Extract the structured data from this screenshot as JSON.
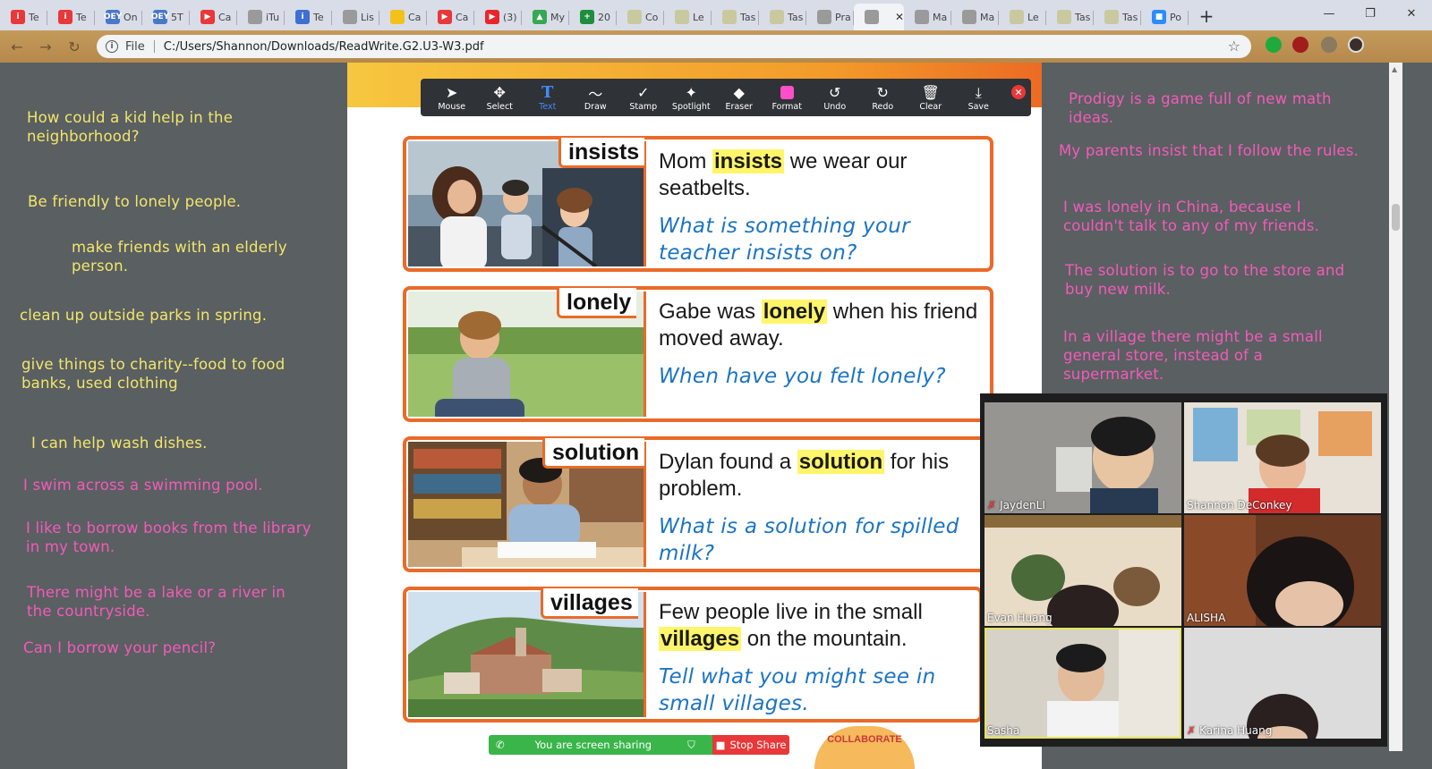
{
  "browser": {
    "tabs": [
      {
        "label": "Te",
        "color": "#e8383a",
        "glyph": "i"
      },
      {
        "label": "Te",
        "color": "#e8383a",
        "glyph": "i"
      },
      {
        "label": "On",
        "color": "#4a78c8",
        "glyph": "OEY"
      },
      {
        "label": "5T",
        "color": "#4a78c8",
        "glyph": "OEY"
      },
      {
        "label": "Ca",
        "color": "#e8383a",
        "glyph": "▶"
      },
      {
        "label": "iTu",
        "color": "#9a9a9a",
        "glyph": ""
      },
      {
        "label": "Te",
        "color": "#3f6fd0",
        "glyph": "i"
      },
      {
        "label": "Lis",
        "color": "#9a9a9a",
        "glyph": ""
      },
      {
        "label": "Ca",
        "color": "#f3c21a",
        "glyph": ""
      },
      {
        "label": "Ca",
        "color": "#e8383a",
        "glyph": "▶"
      },
      {
        "label": "(3)",
        "color": "#e8262a",
        "glyph": "▶"
      },
      {
        "label": "My",
        "color": "#34a853",
        "glyph": "▲"
      },
      {
        "label": "20",
        "color": "#1e8e3e",
        "glyph": "+"
      },
      {
        "label": "Co",
        "color": "#c9c9a0",
        "glyph": ""
      },
      {
        "label": "Le",
        "color": "#c9c9a0",
        "glyph": ""
      },
      {
        "label": "Tas",
        "color": "#c9c9a0",
        "glyph": ""
      },
      {
        "label": "Tas",
        "color": "#c9c9a0",
        "glyph": ""
      },
      {
        "label": "Pra",
        "color": "#9a9a9a",
        "glyph": ""
      },
      {
        "label": "",
        "color": "#9a9a9a",
        "glyph": "",
        "active": true
      },
      {
        "label": "Ma",
        "color": "#9a9a9a",
        "glyph": ""
      },
      {
        "label": "Ma",
        "color": "#9a9a9a",
        "glyph": ""
      },
      {
        "label": "Le",
        "color": "#c9c9a0",
        "glyph": ""
      },
      {
        "label": "Tas",
        "color": "#c9c9a0",
        "glyph": ""
      },
      {
        "label": "Tas",
        "color": "#c9c9a0",
        "glyph": ""
      },
      {
        "label": "Po",
        "color": "#2d8cff",
        "glyph": "■"
      }
    ],
    "new_tab": "+",
    "close_tab": "✕",
    "window": {
      "minimize": "—",
      "restore": "❐",
      "close": "✕"
    },
    "nav": {
      "back": "←",
      "forward": "→",
      "reload": "↻"
    },
    "address": {
      "scheme_label": "File",
      "url": "C:/Users/Shannon/Downloads/ReadWrite.G2.U3-W3.pdf"
    },
    "star": "☆"
  },
  "left_notes": [
    {
      "text": "How could a kid help in the neighborhood?",
      "color": "yellow"
    },
    {
      "text": "Be friendly to lonely people.",
      "color": "yellow"
    },
    {
      "text": "make friends with an elderly person.",
      "color": "yellow"
    },
    {
      "text": "clean up outside parks in spring.",
      "color": "yellow"
    },
    {
      "text": "give things to charity--food to food banks, used clothing",
      "color": "yellow"
    },
    {
      "text": "I can help wash dishes.",
      "color": "yellow"
    },
    {
      "text": "I swim across a swimming pool.",
      "color": "pink"
    },
    {
      "text": "I like to borrow books from the library in my town.",
      "color": "pink"
    },
    {
      "text": "There might be a lake or a river in the countryside.",
      "color": "pink"
    },
    {
      "text": "Can I borrow your pencil?",
      "color": "pink"
    }
  ],
  "annotation_tools": [
    {
      "label": "Mouse",
      "icon": "cursor-icon",
      "glyph": "➤"
    },
    {
      "label": "Select",
      "icon": "move-icon",
      "glyph": "✥"
    },
    {
      "label": "Text",
      "icon": "text-icon",
      "glyph": "T",
      "active": true
    },
    {
      "label": "Draw",
      "icon": "squiggle-icon",
      "glyph": "〜"
    },
    {
      "label": "Stamp",
      "icon": "check-icon",
      "glyph": "✓"
    },
    {
      "label": "Spotlight",
      "icon": "wand-icon",
      "glyph": "✦"
    },
    {
      "label": "Eraser",
      "icon": "eraser-icon",
      "glyph": "◆"
    },
    {
      "label": "Format",
      "icon": "color-swatch-icon",
      "glyph": ""
    },
    {
      "label": "Undo",
      "icon": "undo-icon",
      "glyph": "↺"
    },
    {
      "label": "Redo",
      "icon": "redo-icon",
      "glyph": "↻"
    },
    {
      "label": "Clear",
      "icon": "trash-icon",
      "glyph": "🗑"
    },
    {
      "label": "Save",
      "icon": "save-icon",
      "glyph": "⤓"
    }
  ],
  "vocab": [
    {
      "word": "insists",
      "before": "Mom ",
      "hl": "insists",
      "after": " we wear our seatbelts.",
      "question": "What is something your teacher insists on?"
    },
    {
      "word": "lonely",
      "before": "Gabe was ",
      "hl": "lonely",
      "after": " when his friend moved away.",
      "question": "When have you felt lonely?"
    },
    {
      "word": "solution",
      "before": "Dylan found a ",
      "hl": "solution",
      "after": " for his problem.",
      "question": "What is a solution for spilled milk?"
    },
    {
      "word": "villages",
      "before": "Few people live in the small ",
      "hl": "villages",
      "after": " on the mountain.",
      "question": "Tell what you might see in small villages."
    }
  ],
  "share": {
    "status": "You are screen sharing",
    "stop": "Stop Share"
  },
  "collab_label": "COLLABORATE",
  "right_notes": [
    "Prodigy is a game full of new math ideas.",
    "My parents insist that I follow the rules.",
    "I was lonely in China, because I couldn't talk to any of my friends.",
    "The solution is to go to the store and buy new milk.",
    "In a village there might be a small general store, instead of a supermarket."
  ],
  "participants": [
    {
      "name": "JaydenLI",
      "muted": true
    },
    {
      "name": "Shannon DeConkey",
      "muted": false
    },
    {
      "name": "Evan Huang",
      "muted": false
    },
    {
      "name": "ALISHA",
      "muted": false
    },
    {
      "name": "Sasha",
      "muted": false,
      "speaking": true
    },
    {
      "name": "Karina Huang",
      "muted": true
    }
  ]
}
